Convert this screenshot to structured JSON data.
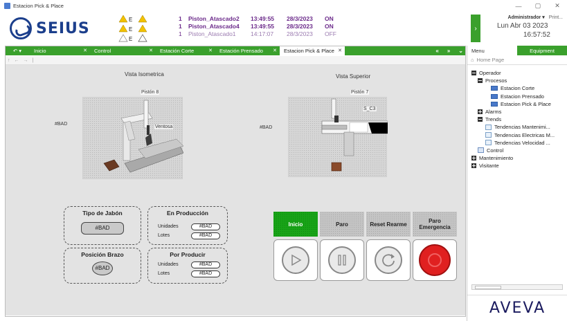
{
  "window": {
    "title": "Estacion Pick & Place",
    "controls": [
      "—",
      "▢",
      "✕"
    ]
  },
  "header": {
    "logo_text": "SEIUS",
    "alarm_counts": [
      "E",
      "E",
      "E"
    ],
    "alarms": [
      {
        "priority": "1",
        "name": "Piston_Atascado2",
        "time": "13:49:55",
        "date": "28/3/2023",
        "state": "ON"
      },
      {
        "priority": "1",
        "name": "Piston_Atascado4",
        "time": "13:49:55",
        "date": "28/3/2023",
        "state": "ON"
      },
      {
        "priority": "1",
        "name": "Piston_Atascado1",
        "time": "14:17:07",
        "date": "28/3/2023",
        "state": "OFF"
      }
    ],
    "user": "Administrador",
    "print": "Print...",
    "date": "Lun Abr 03 2023",
    "time": "16:57:52"
  },
  "tabs": [
    {
      "label": "Inicio"
    },
    {
      "label": "Control"
    },
    {
      "label": "Estación Corte"
    },
    {
      "label": "Estación Prensado"
    },
    {
      "label": "Estacion Pick & Place"
    }
  ],
  "nav": {
    "prev": "«",
    "next": "»",
    "more": "⌄"
  },
  "views": {
    "iso_title": "Vista Isometrica",
    "top_title": "Vista Superior",
    "iso_piston": "Pistón 8",
    "iso_ventosa": "Ventosa",
    "iso_bad": "#BAD",
    "top_piston": "Pistón 7",
    "top_sensor": "S_C3",
    "top_bad": "#BAD"
  },
  "panels": {
    "tipo_jabon": {
      "title": "Tipo de Jabón",
      "value": "#BAD"
    },
    "en_produccion": {
      "title": "En Producción",
      "unidades_label": "Unidades",
      "unidades": "#BAD",
      "lotes_label": "Lotes",
      "lotes": "#BAD"
    },
    "posicion_brazo": {
      "title": "Posición Brazo",
      "value": "#BAD"
    },
    "por_producir": {
      "title": "Por Producir",
      "unidades_label": "Unidades",
      "unidades": "#BAD",
      "lotes_label": "Lotes",
      "lotes": "#BAD"
    }
  },
  "controls": {
    "inicio": "Inicio",
    "paro": "Paro",
    "reset": "Reset Rearme",
    "emergencia": "Paro Emergencia"
  },
  "sidebar": {
    "tab_menu": "Menu",
    "tab_equipment": "Equipment",
    "home": "Home Page",
    "tree": {
      "operador": "Operador",
      "procesos": "Procesos",
      "corte": "Estacion Corte",
      "prensado": "Estacion Prensado",
      "pick": "Estacion Pick & Place",
      "alarms": "Alarms",
      "trends": "Trends",
      "t1": "Tendencias Mantenimi...",
      "t2": "Tendencias Electricas M...",
      "t3": "Tendencias Velocidad ...",
      "control": "Control",
      "mantenimiento": "Mantenimiento",
      "visitante": "Visitante"
    },
    "brand": "AVEVA"
  },
  "colors": {
    "accent_green": "#3aa02c",
    "alarm_purple": "#6b2a8a",
    "brand_blue": "#1c3f8c",
    "emergency_red": "#e02020"
  }
}
